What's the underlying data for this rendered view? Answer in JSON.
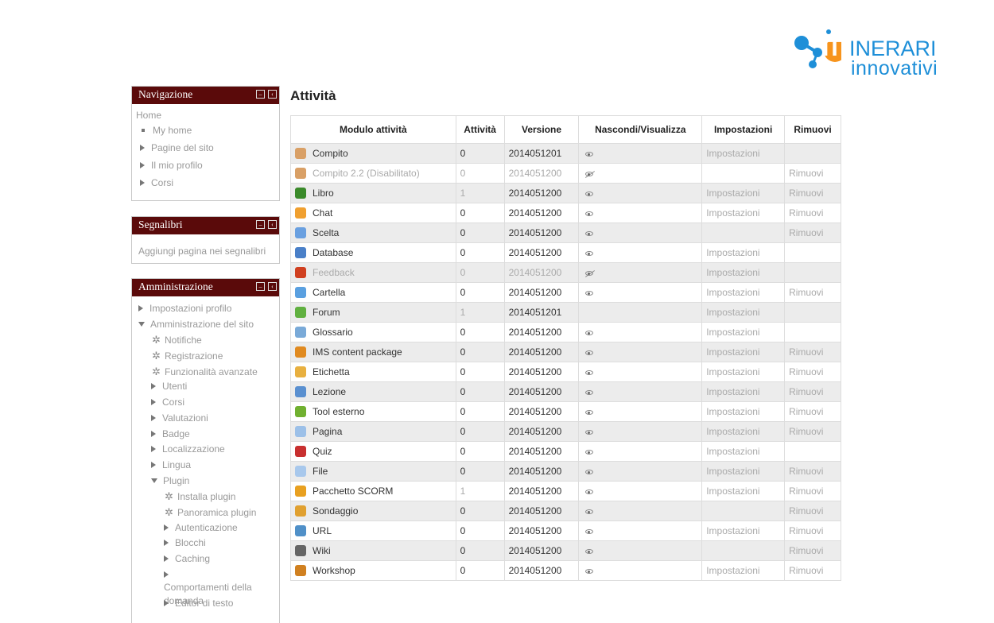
{
  "logo": {
    "part1": "IT",
    "part2": "INERARI",
    "part3": "innovativi"
  },
  "navigation": {
    "title": "Navigazione",
    "home": "Home",
    "items": [
      "My home",
      "Pagine del sito",
      "Il mio profilo",
      "Corsi"
    ]
  },
  "bookmarks": {
    "title": "Segnalibri",
    "add_link": "Aggiungi pagina nei segnalibri"
  },
  "admin": {
    "title": "Amministrazione",
    "items": [
      {
        "label": "Impostazioni profilo",
        "type": "collapsed"
      },
      {
        "label": "Amministrazione del sito",
        "type": "expanded"
      },
      {
        "label": "Notifiche",
        "type": "gear",
        "indent": 1
      },
      {
        "label": "Registrazione",
        "type": "gear",
        "indent": 1
      },
      {
        "label": "Funzionalità avanzate",
        "type": "gear",
        "indent": 1
      },
      {
        "label": "Utenti",
        "type": "collapsed",
        "indent": 1
      },
      {
        "label": "Corsi",
        "type": "collapsed",
        "indent": 1
      },
      {
        "label": "Valutazioni",
        "type": "collapsed",
        "indent": 1
      },
      {
        "label": "Badge",
        "type": "collapsed",
        "indent": 1
      },
      {
        "label": "Localizzazione",
        "type": "collapsed",
        "indent": 1
      },
      {
        "label": "Lingua",
        "type": "collapsed",
        "indent": 1
      },
      {
        "label": "Plugin",
        "type": "expanded",
        "indent": 1
      },
      {
        "label": "Installa plugin",
        "type": "gear",
        "indent": 2
      },
      {
        "label": "Panoramica plugin",
        "type": "gear",
        "indent": 2
      },
      {
        "label": "Autenticazione",
        "type": "collapsed",
        "indent": 2
      },
      {
        "label": "Blocchi",
        "type": "collapsed",
        "indent": 2
      },
      {
        "label": "Caching",
        "type": "collapsed",
        "indent": 2
      },
      {
        "label": "Comportamenti della domanda",
        "type": "collapsed",
        "indent": 2
      },
      {
        "label": "Editor di testo",
        "type": "collapsed",
        "indent": 2
      }
    ]
  },
  "main": {
    "title": "Attività",
    "columns": [
      "Modulo attività",
      "Attività",
      "Versione",
      "Nascondi/Visualizza",
      "Impostazioni",
      "Rimuovi"
    ],
    "rows": [
      {
        "name": "Compito",
        "count": "0",
        "version": "2014051201",
        "visible": true,
        "settings": "Impostazioni",
        "remove": "",
        "icon_color": "#d9a066",
        "disabled": false,
        "count_light": false
      },
      {
        "name": "Compito 2.2 (Disabilitato)",
        "count": "0",
        "version": "2014051200",
        "visible": false,
        "settings": "",
        "remove": "Rimuovi",
        "icon_color": "#d9a066",
        "disabled": true,
        "count_light": false
      },
      {
        "name": "Libro",
        "count": "1",
        "version": "2014051200",
        "visible": true,
        "settings": "Impostazioni",
        "remove": "Rimuovi",
        "icon_color": "#3a8a2a",
        "disabled": false,
        "count_light": true
      },
      {
        "name": "Chat",
        "count": "0",
        "version": "2014051200",
        "visible": true,
        "settings": "Impostazioni",
        "remove": "Rimuovi",
        "icon_color": "#f0a030",
        "disabled": false,
        "count_light": false
      },
      {
        "name": "Scelta",
        "count": "0",
        "version": "2014051200",
        "visible": true,
        "settings": "",
        "remove": "Rimuovi",
        "icon_color": "#6aa0e0",
        "disabled": false,
        "count_light": false
      },
      {
        "name": "Database",
        "count": "0",
        "version": "2014051200",
        "visible": true,
        "settings": "Impostazioni",
        "remove": "",
        "icon_color": "#4a80c8",
        "disabled": false,
        "count_light": false
      },
      {
        "name": "Feedback",
        "count": "0",
        "version": "2014051200",
        "visible": false,
        "settings": "Impostazioni",
        "remove": "",
        "icon_color": "#d04020",
        "disabled": true,
        "count_light": false
      },
      {
        "name": "Cartella",
        "count": "0",
        "version": "2014051200",
        "visible": true,
        "settings": "Impostazioni",
        "remove": "Rimuovi",
        "icon_color": "#5aa0e0",
        "disabled": false,
        "count_light": false
      },
      {
        "name": "Forum",
        "count": "1",
        "version": "2014051201",
        "visible": null,
        "settings": "Impostazioni",
        "remove": "",
        "icon_color": "#60b040",
        "disabled": false,
        "count_light": true
      },
      {
        "name": "Glossario",
        "count": "0",
        "version": "2014051200",
        "visible": true,
        "settings": "Impostazioni",
        "remove": "",
        "icon_color": "#7aaad8",
        "disabled": false,
        "count_light": false
      },
      {
        "name": "IMS content package",
        "count": "0",
        "version": "2014051200",
        "visible": true,
        "settings": "Impostazioni",
        "remove": "Rimuovi",
        "icon_color": "#e08a20",
        "disabled": false,
        "count_light": false
      },
      {
        "name": "Etichetta",
        "count": "0",
        "version": "2014051200",
        "visible": true,
        "settings": "Impostazioni",
        "remove": "Rimuovi",
        "icon_color": "#e8b040",
        "disabled": false,
        "count_light": false
      },
      {
        "name": "Lezione",
        "count": "0",
        "version": "2014051200",
        "visible": true,
        "settings": "Impostazioni",
        "remove": "Rimuovi",
        "icon_color": "#5a90d0",
        "disabled": false,
        "count_light": false
      },
      {
        "name": "Tool esterno",
        "count": "0",
        "version": "2014051200",
        "visible": true,
        "settings": "Impostazioni",
        "remove": "Rimuovi",
        "icon_color": "#70b030",
        "disabled": false,
        "count_light": false
      },
      {
        "name": "Pagina",
        "count": "0",
        "version": "2014051200",
        "visible": true,
        "settings": "Impostazioni",
        "remove": "Rimuovi",
        "icon_color": "#9cc0e8",
        "disabled": false,
        "count_light": false
      },
      {
        "name": "Quiz",
        "count": "0",
        "version": "2014051200",
        "visible": true,
        "settings": "Impostazioni",
        "remove": "",
        "icon_color": "#c83030",
        "disabled": false,
        "count_light": false
      },
      {
        "name": "File",
        "count": "0",
        "version": "2014051200",
        "visible": true,
        "settings": "Impostazioni",
        "remove": "Rimuovi",
        "icon_color": "#a8c8ec",
        "disabled": false,
        "count_light": false
      },
      {
        "name": "Pacchetto SCORM",
        "count": "1",
        "version": "2014051200",
        "visible": true,
        "settings": "Impostazioni",
        "remove": "Rimuovi",
        "icon_color": "#e8a020",
        "disabled": false,
        "count_light": true
      },
      {
        "name": "Sondaggio",
        "count": "0",
        "version": "2014051200",
        "visible": true,
        "settings": "",
        "remove": "Rimuovi",
        "icon_color": "#e0a030",
        "disabled": false,
        "count_light": false
      },
      {
        "name": "URL",
        "count": "0",
        "version": "2014051200",
        "visible": true,
        "settings": "Impostazioni",
        "remove": "Rimuovi",
        "icon_color": "#5090c8",
        "disabled": false,
        "count_light": false
      },
      {
        "name": "Wiki",
        "count": "0",
        "version": "2014051200",
        "visible": true,
        "settings": "",
        "remove": "Rimuovi",
        "icon_color": "#666666",
        "disabled": false,
        "count_light": false
      },
      {
        "name": "Workshop",
        "count": "0",
        "version": "2014051200",
        "visible": true,
        "settings": "Impostazioni",
        "remove": "Rimuovi",
        "icon_color": "#d08020",
        "disabled": false,
        "count_light": false
      }
    ]
  }
}
